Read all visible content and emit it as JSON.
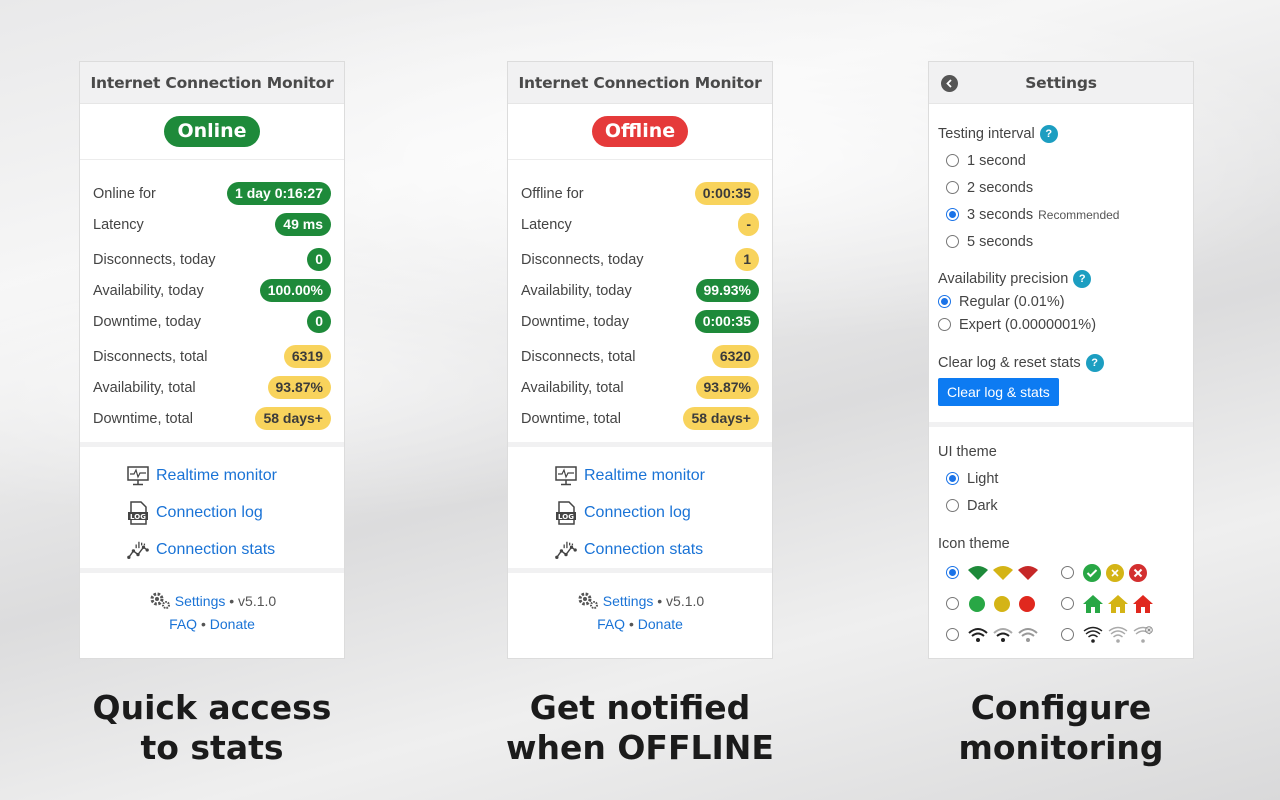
{
  "app_title": "Internet Connection Monitor",
  "panels": {
    "online": {
      "status": "Online",
      "stats": [
        {
          "label": "Online for",
          "value": "1 day 0:16:27"
        },
        {
          "label": "Latency",
          "value": "49 ms"
        },
        {
          "label": "Disconnects, today",
          "value": "0"
        },
        {
          "label": "Availability, today",
          "value": "100.00%"
        },
        {
          "label": "Downtime, today",
          "value": "0"
        },
        {
          "label": "Disconnects, total",
          "value": "6319"
        },
        {
          "label": "Availability, total",
          "value": "93.87%"
        },
        {
          "label": "Downtime, total",
          "value": "58 days+"
        }
      ]
    },
    "offline": {
      "status": "Offline",
      "stats": [
        {
          "label": "Offline for",
          "value": "0:00:35"
        },
        {
          "label": "Latency",
          "value": "-"
        },
        {
          "label": "Disconnects, today",
          "value": "1"
        },
        {
          "label": "Availability, today",
          "value": "99.93%"
        },
        {
          "label": "Downtime, today",
          "value": "0:00:35"
        },
        {
          "label": "Disconnects, total",
          "value": "6320"
        },
        {
          "label": "Availability, total",
          "value": "93.87%"
        },
        {
          "label": "Downtime, total",
          "value": "58 days+"
        }
      ]
    }
  },
  "links": {
    "realtime": "Realtime monitor",
    "log": "Connection log",
    "log_icon_text": "LOG",
    "stats": "Connection stats"
  },
  "footer": {
    "settings": "Settings",
    "version": "• v5.1.0",
    "faq": "FAQ",
    "dot": "•",
    "donate": "Donate"
  },
  "settings": {
    "title": "Settings",
    "testing_interval": "Testing interval",
    "help": "?",
    "intervals": [
      "1 second",
      "2 seconds",
      "3 seconds",
      "5 seconds"
    ],
    "recommended": "Recommended",
    "selected_interval": "3 seconds",
    "availability_precision": "Availability precision",
    "precision_options": [
      "Regular (0.01%)",
      "Expert (0.0000001%)"
    ],
    "selected_precision": "Regular (0.01%)",
    "clear_heading": "Clear log & reset stats",
    "clear_button": "Clear log & stats",
    "ui_theme": "UI theme",
    "themes": [
      "Light",
      "Dark"
    ],
    "selected_theme": "Light",
    "icon_theme": "Icon theme",
    "icon_sets": [
      "wifi-color",
      "circle-status",
      "dots-color",
      "house-color",
      "wifi-black",
      "wifi-outline"
    ],
    "selected_icon_set": "wifi-color"
  },
  "colors": {
    "green": "#1e8a3a",
    "red": "#e53a3a",
    "yellow": "#f8d35c",
    "link": "#1a73d6",
    "accent": "#0d7bf2"
  },
  "captions": {
    "c1_l1": "Quick access",
    "c1_l2": "to stats",
    "c2_l1": "Get notified",
    "c2_l2": "when OFFLINE",
    "c3_l1": "Configure",
    "c3_l2": "monitoring"
  }
}
